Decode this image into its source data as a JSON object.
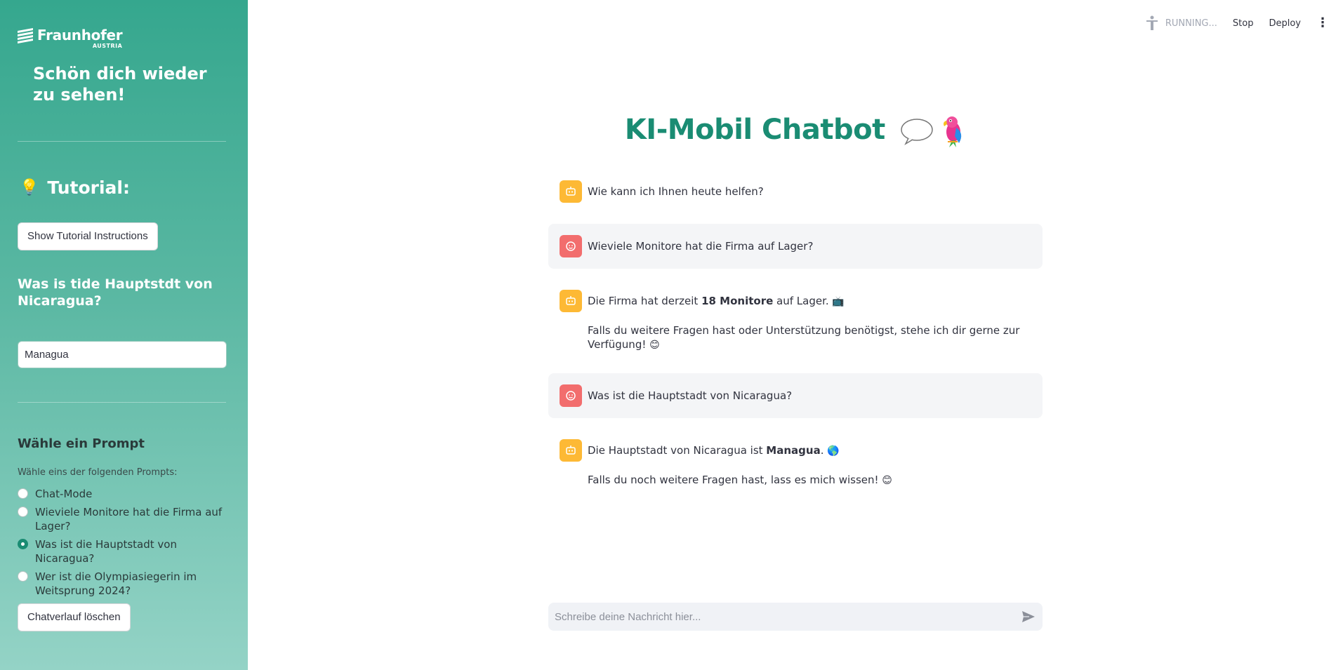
{
  "sidebar": {
    "logo": {
      "name": "Fraunhofer",
      "sub": "AUSTRIA"
    },
    "welcome": "Schön dich wieder zu sehen!",
    "tutorial_heading": "Tutorial:",
    "tutorial_button": "Show Tutorial Instructions",
    "question_label": "Was is tide Hauptstdt von Nicaragua?",
    "answer_value": "Managua",
    "prompt_heading": "Wähle ein Prompt",
    "prompt_sublabel": "Wähle eins der folgenden Prompts:",
    "prompt_options": [
      {
        "label": "Chat-Mode",
        "checked": false
      },
      {
        "label": "Wieviele Monitore hat die Firma auf Lager?",
        "checked": false
      },
      {
        "label": "Was ist die Hauptstadt von Nicaragua?",
        "checked": true
      },
      {
        "label": "Wer ist die Olympiasiegerin im Weitsprung 2024?",
        "checked": false
      }
    ],
    "clear_button": "Chatverlauf löschen"
  },
  "topbar": {
    "status": "RUNNING...",
    "stop": "Stop",
    "deploy": "Deploy"
  },
  "main": {
    "title": "KI-Mobil Chatbot",
    "messages": [
      {
        "role": "bot",
        "paragraphs": [
          [
            {
              "t": "Wie kann ich Ihnen heute helfen?"
            }
          ]
        ]
      },
      {
        "role": "user",
        "paragraphs": [
          [
            {
              "t": "Wieviele Monitore hat die Firma auf Lager?"
            }
          ]
        ]
      },
      {
        "role": "bot",
        "paragraphs": [
          [
            {
              "t": "Die Firma hat derzeit "
            },
            {
              "t": "18 Monitore",
              "b": true
            },
            {
              "t": " auf Lager. "
            },
            {
              "t": "📺",
              "e": true
            }
          ],
          [
            {
              "t": "Falls du weitere Fragen hast oder Unterstützung benötigst, stehe ich dir gerne zur Verfügung! "
            },
            {
              "t": "😊",
              "e": true
            }
          ]
        ]
      },
      {
        "role": "user",
        "paragraphs": [
          [
            {
              "t": "Was ist die Hauptstadt von Nicaragua?"
            }
          ]
        ]
      },
      {
        "role": "bot",
        "paragraphs": [
          [
            {
              "t": "Die Hauptstadt von Nicaragua ist "
            },
            {
              "t": "Managua",
              "b": true
            },
            {
              "t": ". "
            },
            {
              "t": "🌎",
              "e": true
            }
          ],
          [
            {
              "t": "Falls du noch weitere Fragen hast, lass es mich wissen! "
            },
            {
              "t": "😊",
              "e": true
            }
          ]
        ]
      }
    ],
    "chat_placeholder": "Schreibe deine Nachricht hier..."
  },
  "colors": {
    "accent": "#1a8c73",
    "bot_avatar": "#fdb935",
    "user_avatar": "#f26d6d"
  }
}
